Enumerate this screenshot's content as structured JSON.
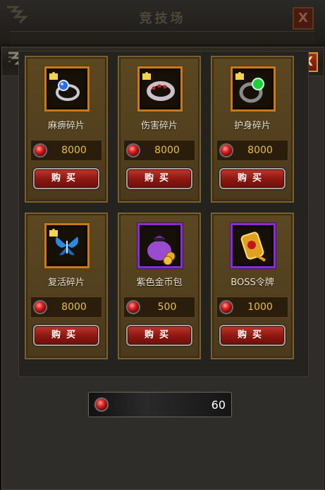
{
  "background_window": {
    "title": "竞技场",
    "close_label": "X"
  },
  "dialog": {
    "close_label": "X"
  },
  "shop_items": [
    {
      "name": "麻痹碎片",
      "price": "8000",
      "buy_label": "购买",
      "icon": "blue-ring-icon",
      "fragment": true,
      "frame": "orange"
    },
    {
      "name": "伤害碎片",
      "price": "8000",
      "buy_label": "购买",
      "icon": "red-ring-icon",
      "fragment": true,
      "frame": "orange"
    },
    {
      "name": "护身碎片",
      "price": "8000",
      "buy_label": "购买",
      "icon": "green-ring-icon",
      "fragment": true,
      "frame": "orange"
    },
    {
      "name": "复活碎片",
      "price": "8000",
      "buy_label": "购买",
      "icon": "butterfly-icon",
      "fragment": true,
      "frame": "orange"
    },
    {
      "name": "紫色金币包",
      "price": "500",
      "buy_label": "购买",
      "icon": "coin-bag-icon",
      "fragment": false,
      "frame": "purple"
    },
    {
      "name": "BOSS令牌",
      "price": "1000",
      "buy_label": "购买",
      "icon": "boss-token-icon",
      "fragment": false,
      "frame": "purple"
    }
  ],
  "balance": {
    "value": "60",
    "icon": "red-gem-icon"
  },
  "colors": {
    "price": "#e8c038",
    "orange_frame": "#c87a1a",
    "purple_frame": "#8b2bd8",
    "buy_button": "#a02018"
  }
}
